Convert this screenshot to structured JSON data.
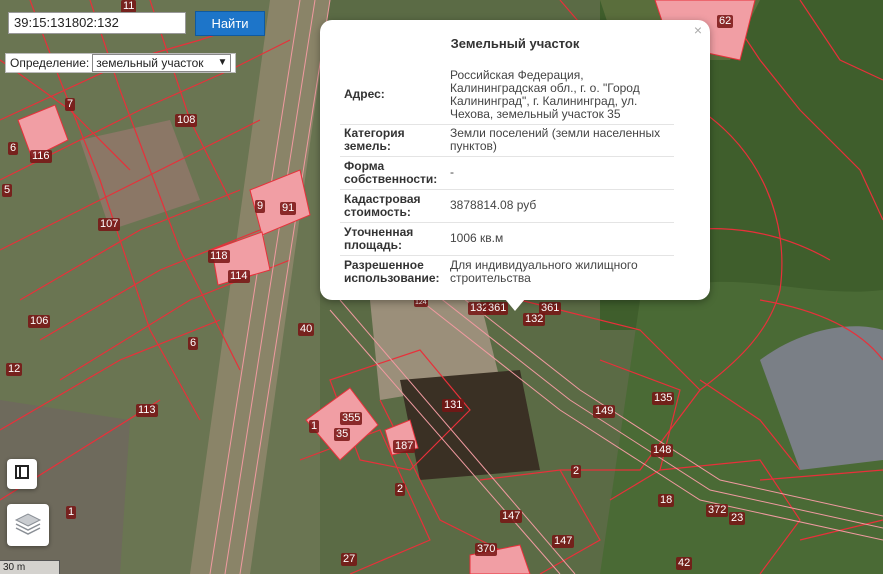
{
  "search": {
    "value": "39:15:131802:132",
    "button_label": "Найти"
  },
  "definition": {
    "label": "Определение:",
    "selected": "земельный участок"
  },
  "popup": {
    "title": "Земельный участок",
    "close_glyph": "×",
    "rows": [
      {
        "key": "Адрес:",
        "value": "Российская Федерация, Калининградская обл., г. о. \"Город Калининград\", г. Калининград, ул. Чехова, земельный участок 35"
      },
      {
        "key": "Категория земель:",
        "value": "Земли поселений (земли населенных пунктов)"
      },
      {
        "key": "Форма собственности:",
        "value": "-"
      },
      {
        "key": "Кадастровая стоимость:",
        "value": "3878814.08 руб"
      },
      {
        "key": "Уточненная площадь:",
        "value": "1006 кв.м"
      },
      {
        "key": "Разрешенное использование:",
        "value": "Для индивидуального жилищного строительства"
      }
    ]
  },
  "map_labels": [
    "11",
    "62",
    "7",
    "108",
    "6",
    "116",
    "5",
    "9",
    "91",
    "107",
    "118",
    "114",
    "106",
    "40",
    "6",
    "12",
    "113",
    "131",
    "1",
    "35",
    "355",
    "187",
    "2",
    "149",
    "135",
    "148",
    "2",
    "18",
    "372",
    "23",
    "147",
    "147",
    "370",
    "42",
    "27",
    "1",
    "132",
    "361",
    "361",
    "132",
    "124"
  ],
  "scale_label": "30 m",
  "icons": {
    "legend": "legend-icon",
    "layers": "layers-icon"
  },
  "colors": {
    "accent": "#1d75c9",
    "parcel_border": "#e8303a",
    "parcel_fill": "#f19ea4"
  }
}
